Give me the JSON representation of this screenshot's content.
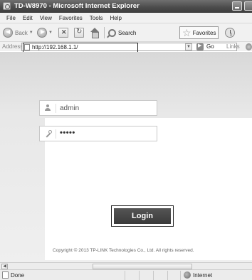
{
  "window": {
    "title": "TD-W8970 - Microsoft Internet Explorer"
  },
  "menu": {
    "items": [
      "File",
      "Edit",
      "View",
      "Favorites",
      "Tools",
      "Help"
    ]
  },
  "toolbar": {
    "back_label": "Back",
    "search_label": "Search",
    "favorites_label": "Favorites"
  },
  "address_bar": {
    "label": "Address",
    "url": "http://192.168.1.1/",
    "go_label": "Go",
    "links_label": "Links"
  },
  "login": {
    "username_value": "admin",
    "password_value": "•••••",
    "button_label": "Login",
    "copyright": "Copyright © 2013 TP-LINK Technologies Co., Ltd. All rights reserved."
  },
  "status_bar": {
    "status_text": "Done",
    "zone_text": "Internet"
  }
}
